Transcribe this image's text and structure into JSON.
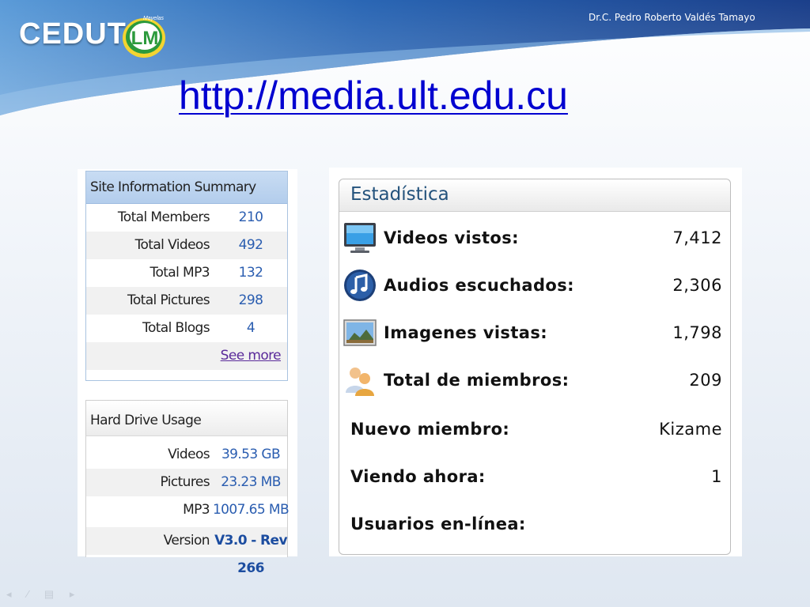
{
  "header": {
    "logo_text": "CEDUT",
    "logo_mark": "LM",
    "logo_mark_arc": "Mayelas",
    "author": "Dr.C. Pedro Roberto Valdés Tamayo",
    "url": "http://media.ult.edu.cu"
  },
  "site_info": {
    "title": "Site Information Summary",
    "rows": [
      {
        "label": "Total Members",
        "value": "210"
      },
      {
        "label": "Total Videos",
        "value": "492"
      },
      {
        "label": "Total MP3",
        "value": "132"
      },
      {
        "label": "Total Pictures",
        "value": "298"
      },
      {
        "label": "Total Blogs",
        "value": "4"
      }
    ],
    "see_more": "See more"
  },
  "hard_drive": {
    "title": "Hard Drive Usage",
    "rows": [
      {
        "label": "Videos",
        "value": "39.53 GB"
      },
      {
        "label": "Pictures",
        "value": "23.23 MB"
      },
      {
        "label": "MP3",
        "value": "1007.65 MB"
      },
      {
        "label": "Version",
        "value": "V3.0 - Rev 266"
      }
    ]
  },
  "stats": {
    "title": "Estadística",
    "rows": [
      {
        "label": "Videos vistos:",
        "value": "7,412",
        "icon": "monitor-icon"
      },
      {
        "label": "Audios escuchados:",
        "value": "2,306",
        "icon": "music-note-icon"
      },
      {
        "label": "Imagenes vistas:",
        "value": "1,798",
        "icon": "picture-icon"
      },
      {
        "label": "Total de miembros:",
        "value": "209",
        "icon": "users-icon"
      },
      {
        "label": "Nuevo miembro:",
        "value": "Kizame"
      },
      {
        "label": "Viendo ahora:",
        "value": "1"
      },
      {
        "label": "Usuarios en-línea:",
        "value": ""
      }
    ]
  },
  "colors": {
    "header_blue": "#1d4f9c",
    "link_blue": "#0000d0",
    "value_blue": "#2a5db0",
    "box_header": "#b3cdec"
  }
}
